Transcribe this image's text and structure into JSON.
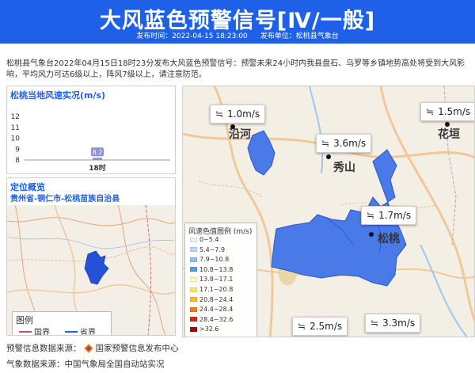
{
  "banner": {
    "title": "大风蓝色预警信号[Ⅳ/一般]",
    "time_label": "发布时间：2022-04-15 18:23:00",
    "unit_label": "发布单位：松桃县气象台"
  },
  "description": "松桃县气象台2022年04月15日18时23分发布大风蓝色预警信号：预警未来24小时内我县盘石、乌罗等乡镇地势高处将受到大风影响，平均风力可达6级以上，阵风7级以上，请注意防范。",
  "wind_chart": {
    "title": "松桃当地风速实况(m/s)",
    "chart_data": {
      "type": "bar",
      "categories": [
        "18时"
      ],
      "values": [
        8.2
      ],
      "title": "松桃当地风速实况(m/s)",
      "xlabel": "",
      "ylabel": "",
      "ylim": [
        8,
        12
      ],
      "yticks": [
        8,
        9,
        10,
        11,
        12
      ],
      "grid": false,
      "color": "#8f8fd8"
    }
  },
  "location": {
    "title": "定位概览",
    "region": "贵州省-铜仁市-松桃苗族自治县",
    "legend_title": "图例",
    "legend_items": [
      {
        "label": "国界",
        "color": "#c0506c"
      },
      {
        "label": "省界",
        "color": "#1f60e8"
      }
    ]
  },
  "detail_map": {
    "cities": [
      "沿河",
      "秀山",
      "松桃",
      "花垣"
    ],
    "wind_tags": [
      "1.0m/s",
      "1.5m/s",
      "3.6m/s",
      "1.7m/s",
      "2.5m/s",
      "3.3m/s"
    ],
    "warning_color": "#4a79e8",
    "legend_title": "风速色值图例 (m/s)",
    "legend_items": [
      {
        "label": "0~5.4",
        "color": "#e6f1fb"
      },
      {
        "label": "5.4~7.9",
        "color": "#bcd9f4"
      },
      {
        "label": "7.9~10.8",
        "color": "#8dbfec"
      },
      {
        "label": "10.8~13.8",
        "color": "#5a9ae0"
      },
      {
        "label": "13.8~17.1",
        "color": "#ffffb2"
      },
      {
        "label": "17.1~20.8",
        "color": "#ffe270"
      },
      {
        "label": "20.8~24.4",
        "color": "#ffb833"
      },
      {
        "label": "24.4~28.4",
        "color": "#f57a1f"
      },
      {
        "label": "28.4~32.6",
        "color": "#d9261c"
      },
      {
        "label": ">32.6",
        "color": "#9c0d0d"
      }
    ]
  },
  "footer": {
    "warning_source_label": "预警信息数据来源：",
    "warning_source": "国家预警信息发布中心",
    "weather_source": "气象数据来源：中国气象局全国自动站实况"
  },
  "icons": {
    "wind": "wind-icon",
    "logo": "nmc-logo-icon"
  }
}
